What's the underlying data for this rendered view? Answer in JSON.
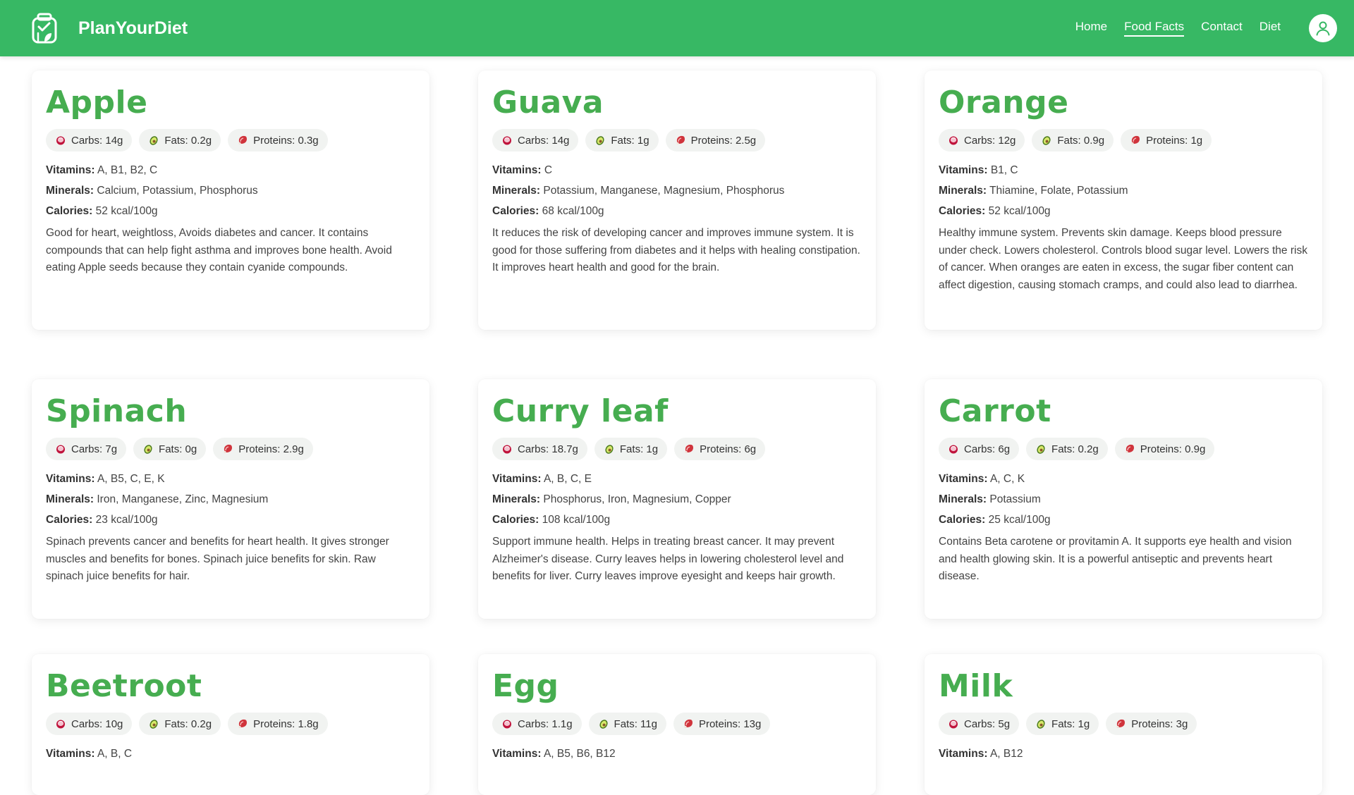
{
  "app": {
    "brand": "PlanYourDiet",
    "accent_color": "#37b864",
    "title_color": "#46ad50"
  },
  "nav": {
    "items": [
      {
        "label": "Home",
        "active": false
      },
      {
        "label": "Food Facts",
        "active": true
      },
      {
        "label": "Contact",
        "active": false
      },
      {
        "label": "Diet",
        "active": false
      }
    ],
    "avatar_icon": "user-icon"
  },
  "labels": {
    "vitamins": "Vitamins:",
    "minerals": "Minerals:",
    "calories": "Calories:"
  },
  "foods": [
    {
      "name": "Apple",
      "carbs": "Carbs: 14g",
      "fats": "Fats: 0.2g",
      "proteins": "Proteins: 0.3g",
      "vitamins": "A, B1, B2, C",
      "minerals": "Calcium, Potassium, Phosphorus",
      "calories": "52 kcal/100g",
      "description": "Good for heart, weightloss, Avoids diabetes and cancer. It contains compounds that can help fight asthma and improves bone health. Avoid eating Apple seeds because they contain cyanide compounds."
    },
    {
      "name": "Guava",
      "carbs": "Carbs: 14g",
      "fats": "Fats: 1g",
      "proteins": "Proteins: 2.5g",
      "vitamins": "C",
      "minerals": "Potassium, Manganese, Magnesium, Phosphorus",
      "calories": "68 kcal/100g",
      "description": "It reduces the risk of developing cancer and improves immune system. It is good for those suffering from diabetes and it helps with healing constipation. It improves heart health and good for the brain."
    },
    {
      "name": "Orange",
      "carbs": "Carbs: 12g",
      "fats": "Fats: 0.9g",
      "proteins": "Proteins: 1g",
      "vitamins": "B1, C",
      "minerals": "Thiamine, Folate, Potassium",
      "calories": "52 kcal/100g",
      "description": "Healthy immune system. Prevents skin damage. Keeps blood pressure under check. Lowers cholesterol. Controls blood sugar level. Lowers the risk of cancer. When oranges are eaten in excess, the sugar fiber content can affect digestion, causing stomach cramps, and could also lead to diarrhea."
    },
    {
      "name": "Spinach",
      "carbs": "Carbs: 7g",
      "fats": "Fats: 0g",
      "proteins": "Proteins: 2.9g",
      "vitamins": "A, B5, C, E, K",
      "minerals": "Iron, Manganese, Zinc, Magnesium",
      "calories": "23 kcal/100g",
      "description": "Spinach prevents cancer and benefits for heart health. It gives stronger muscles and benefits for bones. Spinach juice benefits for skin. Raw spinach juice benefits for hair."
    },
    {
      "name": "Curry leaf",
      "carbs": "Carbs: 18.7g",
      "fats": "Fats: 1g",
      "proteins": "Proteins: 6g",
      "vitamins": "A, B, C, E",
      "minerals": "Phosphorus, Iron, Magnesium, Copper",
      "calories": "108 kcal/100g",
      "description": "Support immune health. Helps in treating breast cancer. It may prevent Alzheimer's disease. Curry leaves helps in lowering cholesterol level and benefits for liver. Curry leaves improve eyesight and keeps hair growth."
    },
    {
      "name": "Carrot",
      "carbs": "Carbs: 6g",
      "fats": "Fats: 0.2g",
      "proteins": "Proteins: 0.9g",
      "vitamins": "A, C, K",
      "minerals": "Potassium",
      "calories": "25 kcal/100g",
      "description": "Contains Beta carotene or provitamin A. It supports eye health and vision and health glowing skin. It is a powerful antiseptic and prevents heart disease."
    },
    {
      "name": "Beetroot",
      "carbs": "Carbs: 10g",
      "fats": "Fats: 0.2g",
      "proteins": "Proteins: 1.8g",
      "vitamins": "A, B, C"
    },
    {
      "name": "Egg",
      "carbs": "Carbs: 1.1g",
      "fats": "Fats: 11g",
      "proteins": "Proteins: 13g",
      "vitamins": "A, B5, B6, B12"
    },
    {
      "name": "Milk",
      "carbs": "Carbs: 5g",
      "fats": "Fats: 1g",
      "proteins": "Proteins: 3g",
      "vitamins": "A, B12"
    }
  ]
}
